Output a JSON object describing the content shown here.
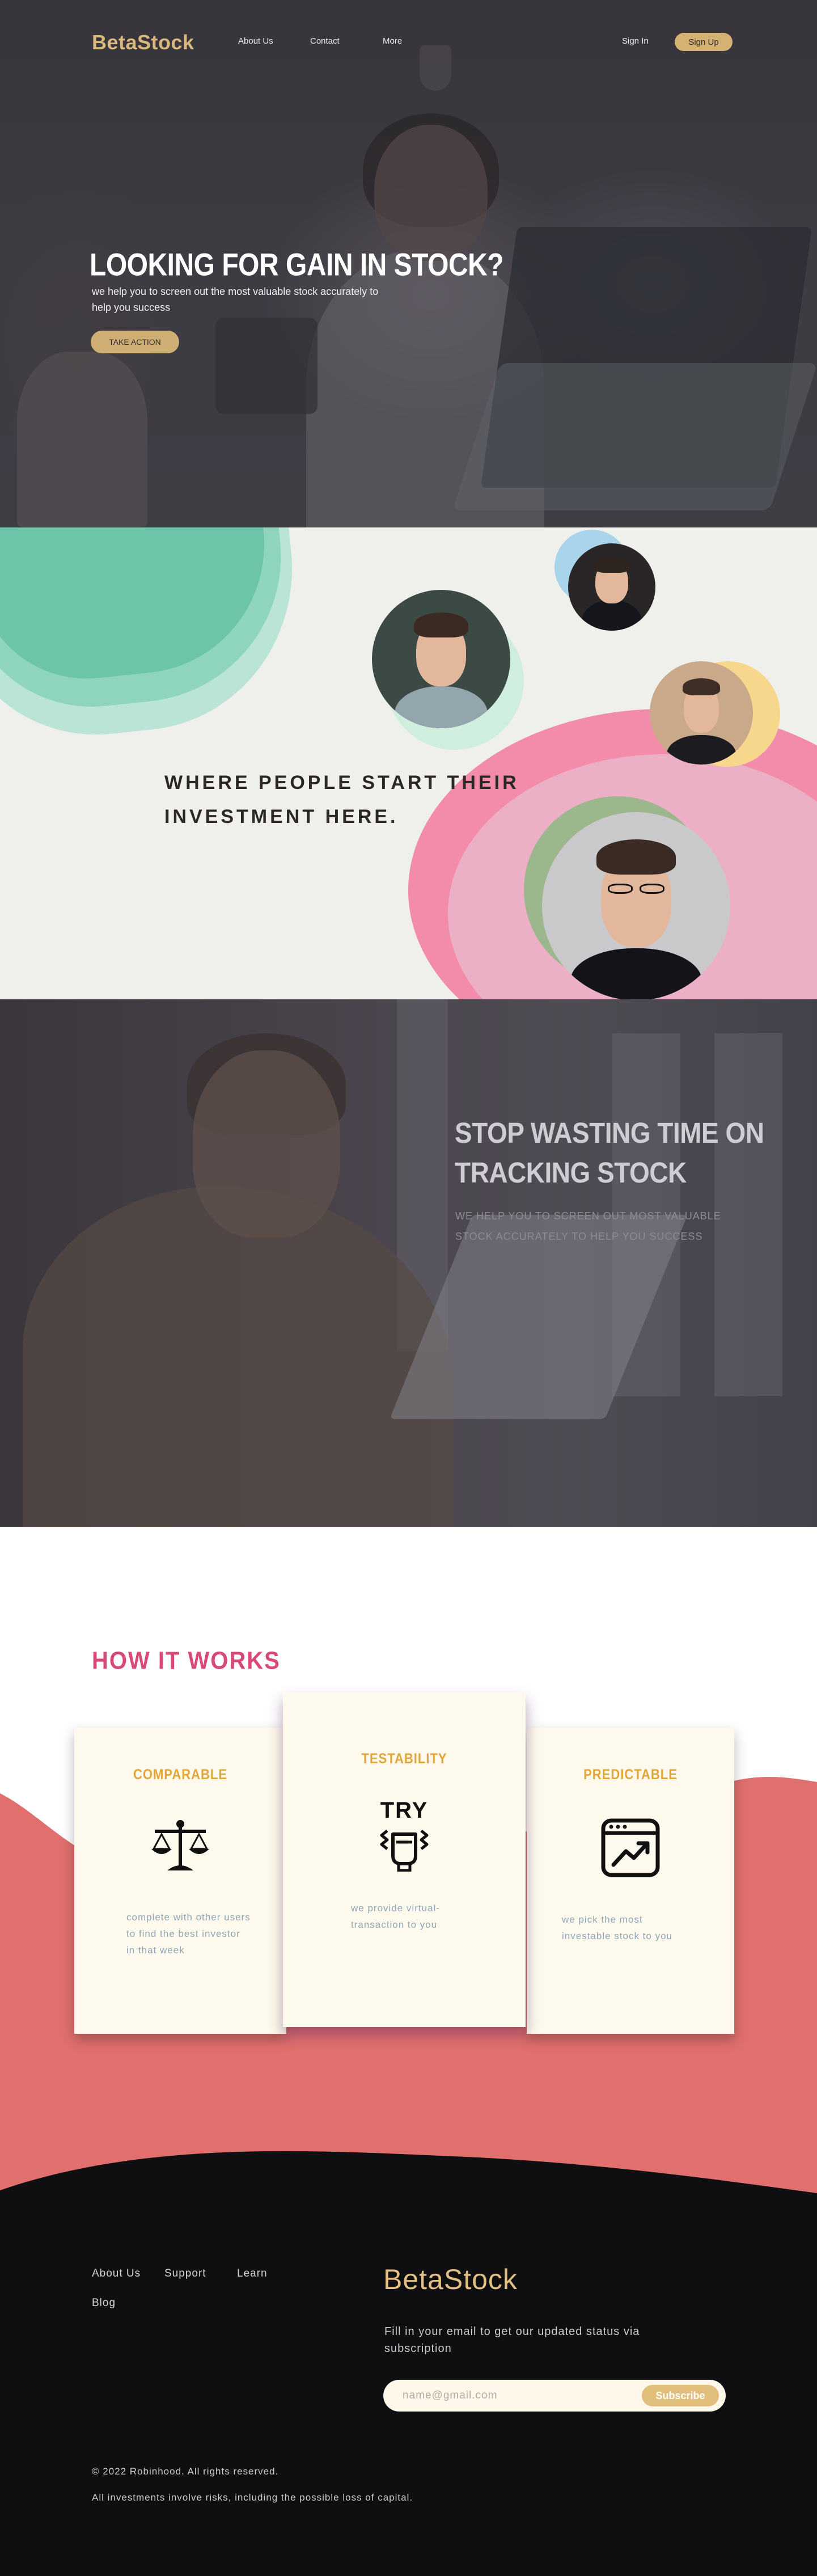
{
  "nav": {
    "brand": "BetaStock",
    "links": [
      "About Us",
      "Contact",
      "More"
    ],
    "sign_in": "Sign In",
    "sign_up": "Sign Up"
  },
  "hero": {
    "title": "LOOKING FOR GAIN IN STOCK?",
    "subtitle": "we help you to screen out the most valuable stock accurately to help you success",
    "cta": "TAKE ACTION"
  },
  "people": {
    "title": "WHERE PEOPLE START THEIR INVESTMENT HERE."
  },
  "stop": {
    "title": "STOP WASTING TIME ON TRACKING STOCK",
    "subtitle": "WE HELP YOU TO SCREEN OUT MOST VALUABLE STOCK ACCURATELY TO HELP YOU SUCCESS"
  },
  "how": {
    "title": "HOW IT WORKS",
    "cards": [
      {
        "title": "COMPARABLE",
        "icon": "scale-icon",
        "text": "complete with other users to find the best investor in that week"
      },
      {
        "title": "TESTABILITY",
        "icon": "try-icon",
        "icon_label": "TRY",
        "text": "we provide virtual-transaction to you"
      },
      {
        "title": "PREDICTABLE",
        "icon": "chart-window-icon",
        "text": "we pick the most investable stock to you"
      }
    ]
  },
  "footer": {
    "links": [
      "About Us",
      "Support",
      "Learn",
      "Blog"
    ],
    "brand": "BetaStock",
    "subscribe_text": "Fill in your email to get our updated status via subscription",
    "email_placeholder": "name@gmail.com",
    "subscribe_button": "Subscribe",
    "copyright": "© 2022 Robinhood. All rights reserved.",
    "disclaimer": "All investments involve risks, including the possible loss of capital."
  },
  "colors": {
    "gold": "#d5b272",
    "pink_title": "#d94976",
    "coral_wave": "#e06f6d",
    "card_title": "#e2a537",
    "footer_bg": "#0f0e10"
  }
}
